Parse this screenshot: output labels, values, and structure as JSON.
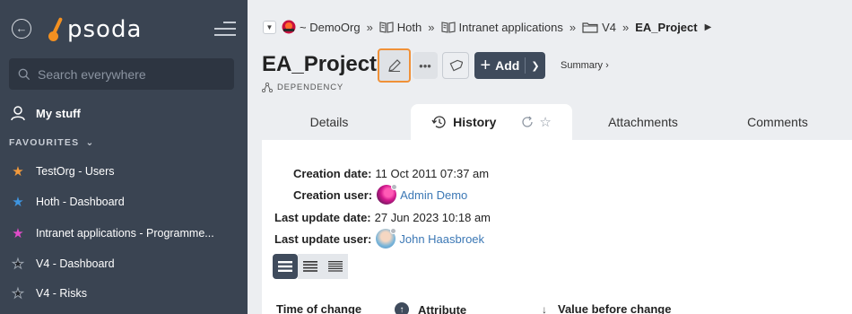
{
  "app": {
    "name": "psoda"
  },
  "sidebar": {
    "search_placeholder": "Search everywhere",
    "my_stuff": "My stuff",
    "favourites_label": "FAVOURITES",
    "favourites": [
      {
        "label": "TestOrg - Users",
        "star_color": "#f39a3c"
      },
      {
        "label": "Hoth - Dashboard",
        "star_color": "#3e95e0"
      },
      {
        "label": "Intranet applications - Programme...",
        "star_color": "#e04cc9"
      },
      {
        "label": "V4 - Dashboard",
        "star_color": "#1e2228"
      },
      {
        "label": "V4 - Risks",
        "star_color": "#1e2228"
      }
    ]
  },
  "breadcrumb": {
    "items": [
      "~ DemoOrg",
      "Hoth",
      "Intranet applications",
      "V4",
      "EA_Project"
    ],
    "separator": "»"
  },
  "header": {
    "title": "EA_Project",
    "object_type": "DEPENDENCY",
    "add_label": "Add",
    "summary_label": "Summary ›"
  },
  "tabs": {
    "details": "Details",
    "history": "History",
    "attachments": "Attachments",
    "comments": "Comments"
  },
  "history": {
    "creation_date_label": "Creation date:",
    "creation_date": "11 Oct 2011 07:37 am",
    "creation_user_label": "Creation user:",
    "creation_user": "Admin Demo",
    "last_update_date_label": "Last update date:",
    "last_update_date": "27 Jun 2023 10:18 am",
    "last_update_user_label": "Last update user:",
    "last_update_user": "John Haasbroek",
    "columns": [
      "Time of change",
      "Attribute",
      "Value before change"
    ]
  },
  "colors": {
    "sidebar_bg": "#3a4452",
    "accent_orange": "#f09138",
    "primary_button": "#3f4b5c",
    "link": "#3c78b5"
  }
}
